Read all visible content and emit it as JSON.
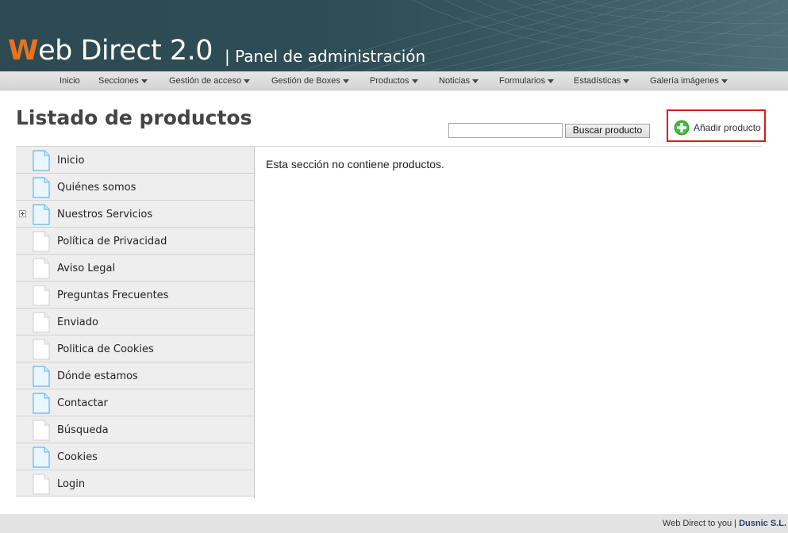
{
  "header": {
    "logo_first_letter": "W",
    "logo_rest": "eb Direct 2.0",
    "subtitle": "| Panel de administración"
  },
  "nav": {
    "items": [
      {
        "label": "Inicio",
        "dropdown": false
      },
      {
        "label": "Secciones",
        "dropdown": true
      },
      {
        "label": "Gestión de acceso",
        "dropdown": true
      },
      {
        "label": "Gestión de Boxes",
        "dropdown": true
      },
      {
        "label": "Productos",
        "dropdown": true
      },
      {
        "label": "Noticias",
        "dropdown": true
      },
      {
        "label": "Formularios",
        "dropdown": true
      },
      {
        "label": "Estadísticas",
        "dropdown": true
      },
      {
        "label": "Galería imágenes",
        "dropdown": true
      }
    ]
  },
  "main": {
    "title": "Listado de productos",
    "search": {
      "value": "",
      "placeholder": "",
      "button_label": "Buscar producto"
    },
    "add_product_label": "Añadir producto",
    "empty_message": "Esta sección no contiene productos."
  },
  "sidebar": {
    "items": [
      {
        "label": "Inicio",
        "icon": "page-blue-icon",
        "expandable": false
      },
      {
        "label": "Quiénes somos",
        "icon": "page-blue-icon",
        "expandable": false
      },
      {
        "label": "Nuestros Servicios",
        "icon": "page-blue-icon",
        "expandable": true
      },
      {
        "label": "Política de Privacidad",
        "icon": "page-white-icon",
        "expandable": false
      },
      {
        "label": "Aviso Legal",
        "icon": "page-white-icon",
        "expandable": false
      },
      {
        "label": "Preguntas Frecuentes",
        "icon": "page-white-icon",
        "expandable": false
      },
      {
        "label": "Enviado",
        "icon": "page-white-icon",
        "expandable": false
      },
      {
        "label": "Politica de Cookies",
        "icon": "page-white-icon",
        "expandable": false
      },
      {
        "label": "Dónde estamos",
        "icon": "page-blue-icon",
        "expandable": false
      },
      {
        "label": "Contactar",
        "icon": "page-blue-icon",
        "expandable": false
      },
      {
        "label": "Búsqueda",
        "icon": "page-white-icon",
        "expandable": false
      },
      {
        "label": "Cookies",
        "icon": "page-blue-icon",
        "expandable": false
      },
      {
        "label": "Login",
        "icon": "page-white-icon",
        "expandable": false
      }
    ]
  },
  "footer": {
    "text": "Web Direct to you |",
    "company": "Dusnic S.L."
  },
  "colors": {
    "accent_orange": "#e8731c",
    "banner": "#2f4d55",
    "highlight_red": "#e01818",
    "add_green": "#3aa13a",
    "page_icon_blue": "#5fb8e8"
  }
}
